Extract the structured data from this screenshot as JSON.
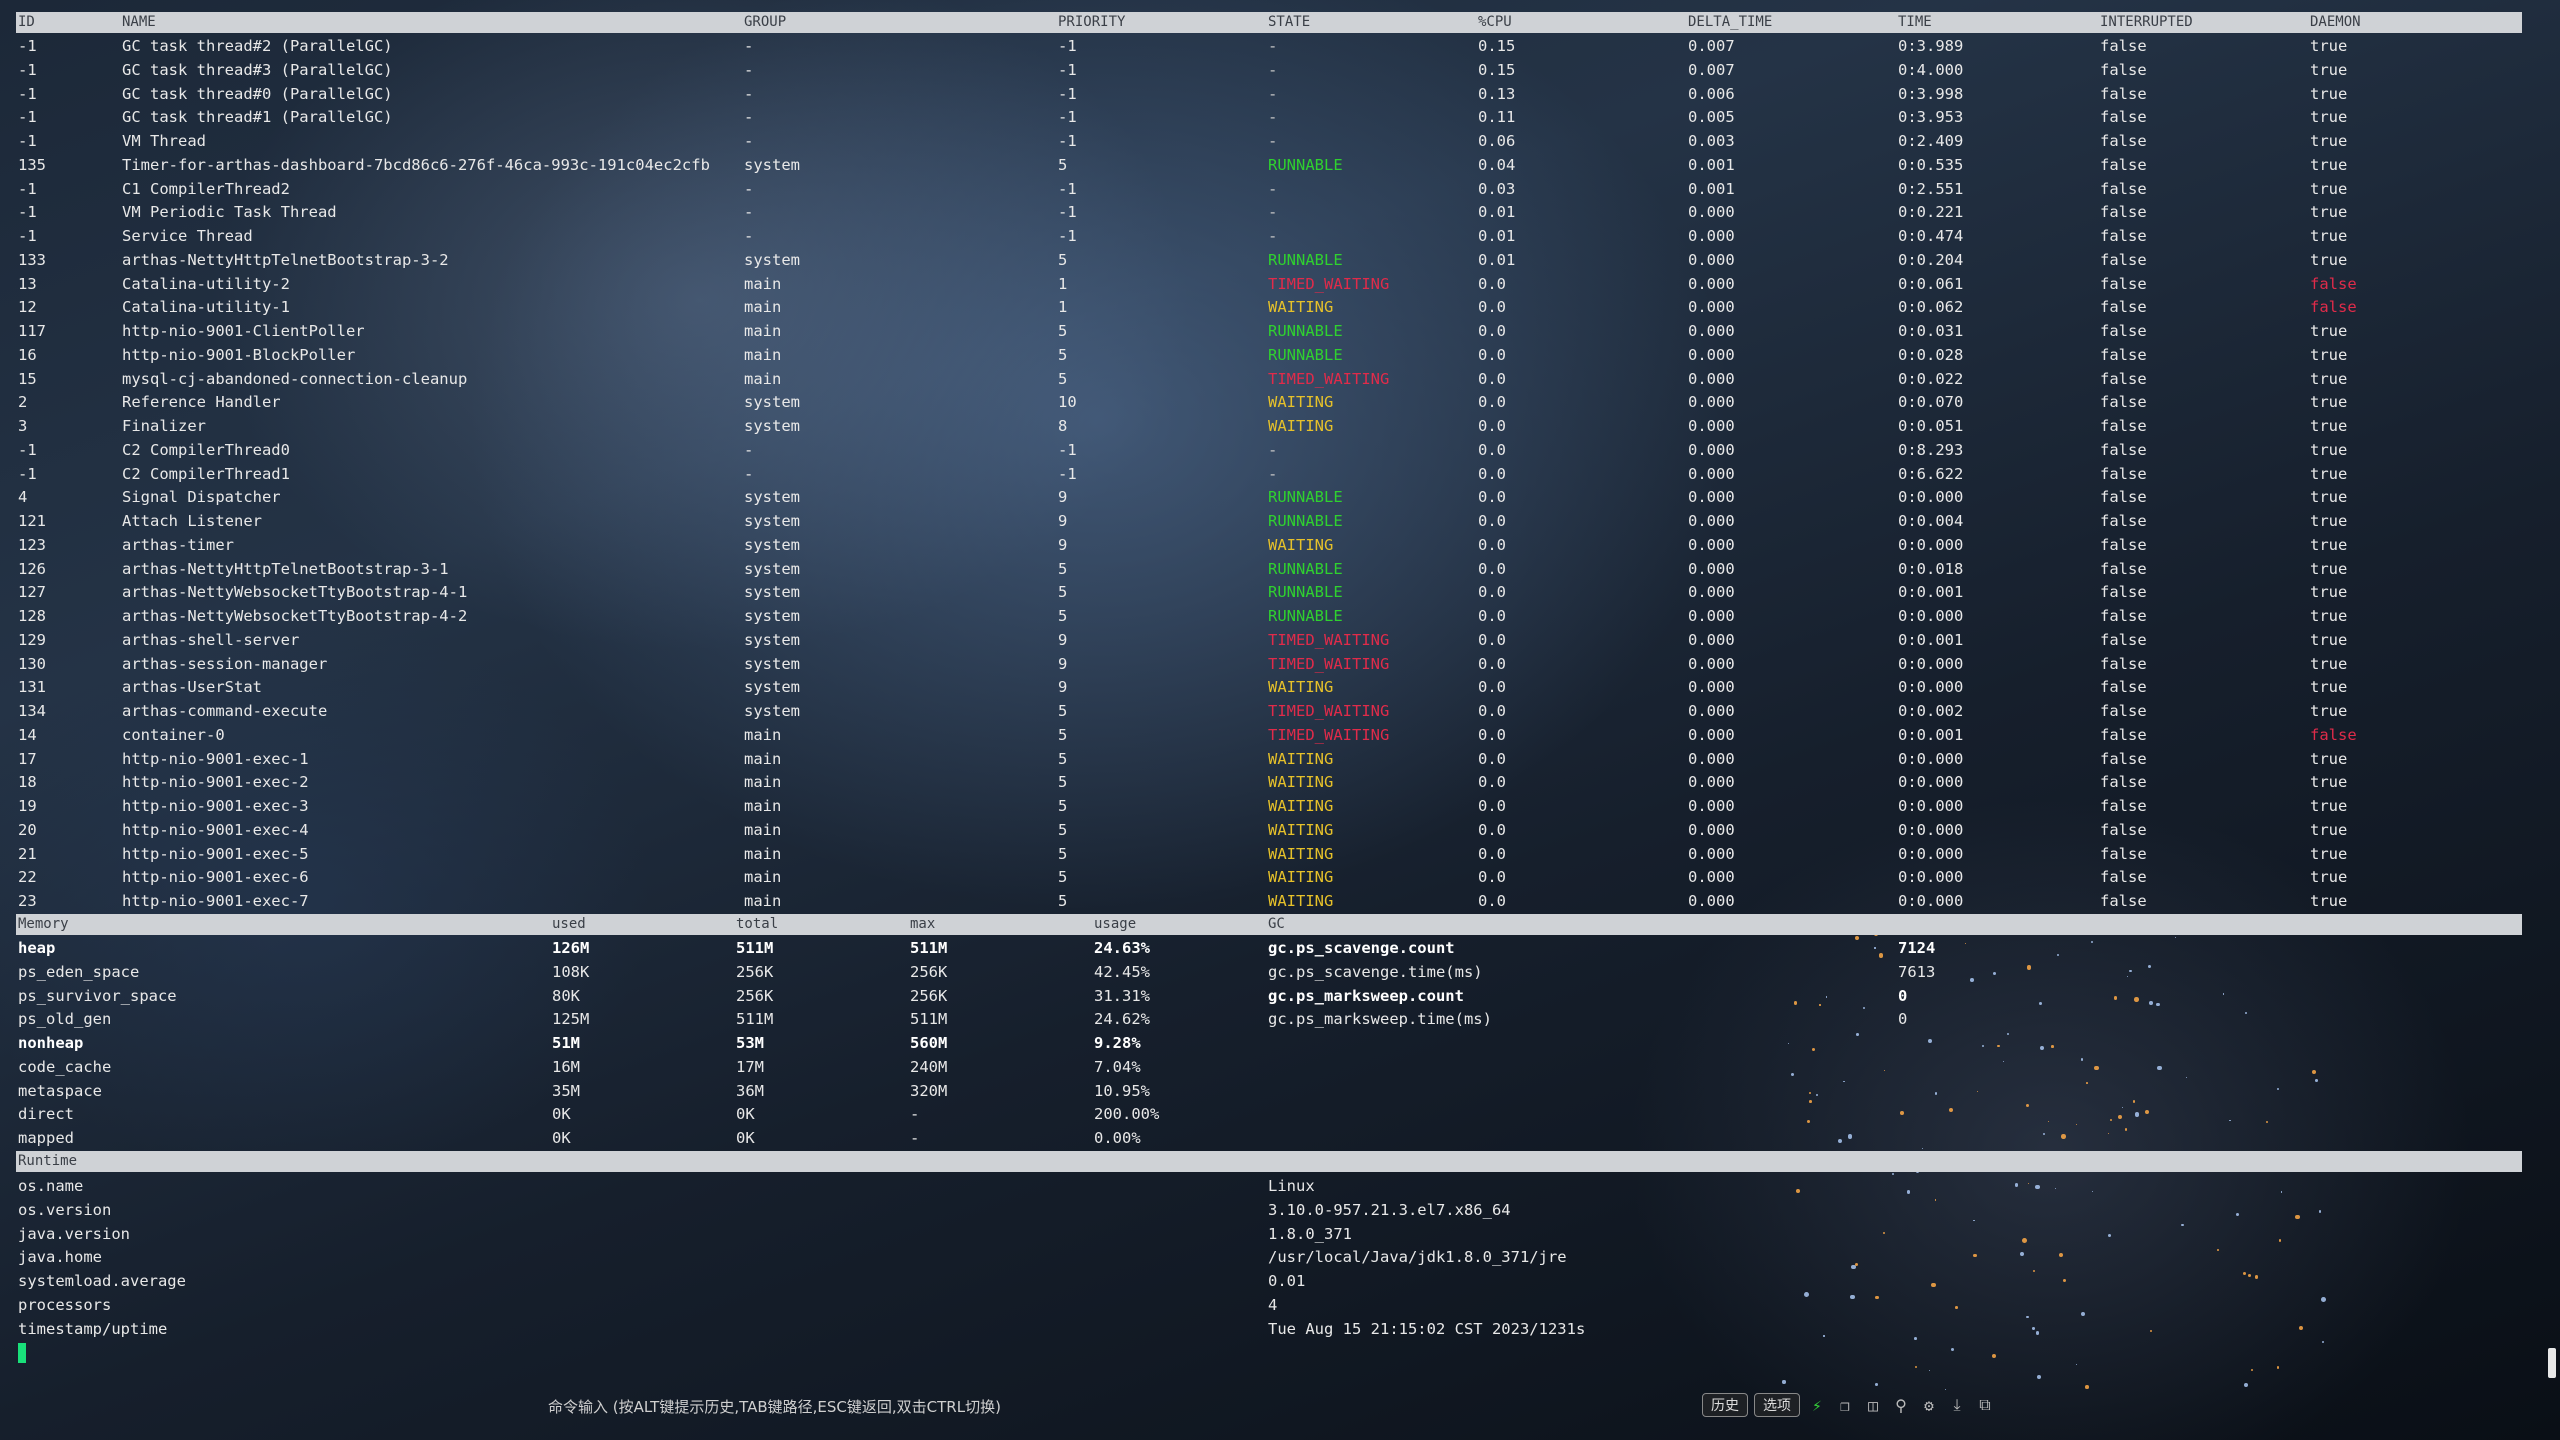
{
  "threads": {
    "headers": [
      "ID",
      "NAME",
      "GROUP",
      "PRIORITY",
      "STATE",
      "%CPU",
      "DELTA_TIME",
      "TIME",
      "INTERRUPTED",
      "DAEMON"
    ],
    "rows": [
      [
        "-1",
        "GC task thread#2 (ParallelGC)",
        "-",
        "-1",
        "-",
        "0.15",
        "0.007",
        "0:3.989",
        "false",
        "true"
      ],
      [
        "-1",
        "GC task thread#3 (ParallelGC)",
        "-",
        "-1",
        "-",
        "0.15",
        "0.007",
        "0:4.000",
        "false",
        "true"
      ],
      [
        "-1",
        "GC task thread#0 (ParallelGC)",
        "-",
        "-1",
        "-",
        "0.13",
        "0.006",
        "0:3.998",
        "false",
        "true"
      ],
      [
        "-1",
        "GC task thread#1 (ParallelGC)",
        "-",
        "-1",
        "-",
        "0.11",
        "0.005",
        "0:3.953",
        "false",
        "true"
      ],
      [
        "-1",
        "VM Thread",
        "-",
        "-1",
        "-",
        "0.06",
        "0.003",
        "0:2.409",
        "false",
        "true"
      ],
      [
        "135",
        "Timer-for-arthas-dashboard-7bcd86c6-276f-46ca-993c-191c04ec2cfb",
        "system",
        "5",
        "RUNNABLE",
        "0.04",
        "0.001",
        "0:0.535",
        "false",
        "true"
      ],
      [
        "-1",
        "C1 CompilerThread2",
        "-",
        "-1",
        "-",
        "0.03",
        "0.001",
        "0:2.551",
        "false",
        "true"
      ],
      [
        "-1",
        "VM Periodic Task Thread",
        "-",
        "-1",
        "-",
        "0.01",
        "0.000",
        "0:0.221",
        "false",
        "true"
      ],
      [
        "-1",
        "Service Thread",
        "-",
        "-1",
        "-",
        "0.01",
        "0.000",
        "0:0.474",
        "false",
        "true"
      ],
      [
        "133",
        "arthas-NettyHttpTelnetBootstrap-3-2",
        "system",
        "5",
        "RUNNABLE",
        "0.01",
        "0.000",
        "0:0.204",
        "false",
        "true"
      ],
      [
        "13",
        "Catalina-utility-2",
        "main",
        "1",
        "TIMED_WAITING",
        "0.0",
        "0.000",
        "0:0.061",
        "false",
        "false"
      ],
      [
        "12",
        "Catalina-utility-1",
        "main",
        "1",
        "WAITING",
        "0.0",
        "0.000",
        "0:0.062",
        "false",
        "false"
      ],
      [
        "117",
        "http-nio-9001-ClientPoller",
        "main",
        "5",
        "RUNNABLE",
        "0.0",
        "0.000",
        "0:0.031",
        "false",
        "true"
      ],
      [
        "16",
        "http-nio-9001-BlockPoller",
        "main",
        "5",
        "RUNNABLE",
        "0.0",
        "0.000",
        "0:0.028",
        "false",
        "true"
      ],
      [
        "15",
        "mysql-cj-abandoned-connection-cleanup",
        "main",
        "5",
        "TIMED_WAITING",
        "0.0",
        "0.000",
        "0:0.022",
        "false",
        "true"
      ],
      [
        "2",
        "Reference Handler",
        "system",
        "10",
        "WAITING",
        "0.0",
        "0.000",
        "0:0.070",
        "false",
        "true"
      ],
      [
        "3",
        "Finalizer",
        "system",
        "8",
        "WAITING",
        "0.0",
        "0.000",
        "0:0.051",
        "false",
        "true"
      ],
      [
        "-1",
        "C2 CompilerThread0",
        "-",
        "-1",
        "-",
        "0.0",
        "0.000",
        "0:8.293",
        "false",
        "true"
      ],
      [
        "-1",
        "C2 CompilerThread1",
        "-",
        "-1",
        "-",
        "0.0",
        "0.000",
        "0:6.622",
        "false",
        "true"
      ],
      [
        "4",
        "Signal Dispatcher",
        "system",
        "9",
        "RUNNABLE",
        "0.0",
        "0.000",
        "0:0.000",
        "false",
        "true"
      ],
      [
        "121",
        "Attach Listener",
        "system",
        "9",
        "RUNNABLE",
        "0.0",
        "0.000",
        "0:0.004",
        "false",
        "true"
      ],
      [
        "123",
        "arthas-timer",
        "system",
        "9",
        "WAITING",
        "0.0",
        "0.000",
        "0:0.000",
        "false",
        "true"
      ],
      [
        "126",
        "arthas-NettyHttpTelnetBootstrap-3-1",
        "system",
        "5",
        "RUNNABLE",
        "0.0",
        "0.000",
        "0:0.018",
        "false",
        "true"
      ],
      [
        "127",
        "arthas-NettyWebsocketTtyBootstrap-4-1",
        "system",
        "5",
        "RUNNABLE",
        "0.0",
        "0.000",
        "0:0.001",
        "false",
        "true"
      ],
      [
        "128",
        "arthas-NettyWebsocketTtyBootstrap-4-2",
        "system",
        "5",
        "RUNNABLE",
        "0.0",
        "0.000",
        "0:0.000",
        "false",
        "true"
      ],
      [
        "129",
        "arthas-shell-server",
        "system",
        "9",
        "TIMED_WAITING",
        "0.0",
        "0.000",
        "0:0.001",
        "false",
        "true"
      ],
      [
        "130",
        "arthas-session-manager",
        "system",
        "9",
        "TIMED_WAITING",
        "0.0",
        "0.000",
        "0:0.000",
        "false",
        "true"
      ],
      [
        "131",
        "arthas-UserStat",
        "system",
        "9",
        "WAITING",
        "0.0",
        "0.000",
        "0:0.000",
        "false",
        "true"
      ],
      [
        "134",
        "arthas-command-execute",
        "system",
        "5",
        "TIMED_WAITING",
        "0.0",
        "0.000",
        "0:0.002",
        "false",
        "true"
      ],
      [
        "14",
        "container-0",
        "main",
        "5",
        "TIMED_WAITING",
        "0.0",
        "0.000",
        "0:0.001",
        "false",
        "false"
      ],
      [
        "17",
        "http-nio-9001-exec-1",
        "main",
        "5",
        "WAITING",
        "0.0",
        "0.000",
        "0:0.000",
        "false",
        "true"
      ],
      [
        "18",
        "http-nio-9001-exec-2",
        "main",
        "5",
        "WAITING",
        "0.0",
        "0.000",
        "0:0.000",
        "false",
        "true"
      ],
      [
        "19",
        "http-nio-9001-exec-3",
        "main",
        "5",
        "WAITING",
        "0.0",
        "0.000",
        "0:0.000",
        "false",
        "true"
      ],
      [
        "20",
        "http-nio-9001-exec-4",
        "main",
        "5",
        "WAITING",
        "0.0",
        "0.000",
        "0:0.000",
        "false",
        "true"
      ],
      [
        "21",
        "http-nio-9001-exec-5",
        "main",
        "5",
        "WAITING",
        "0.0",
        "0.000",
        "0:0.000",
        "false",
        "true"
      ],
      [
        "22",
        "http-nio-9001-exec-6",
        "main",
        "5",
        "WAITING",
        "0.0",
        "0.000",
        "0:0.000",
        "false",
        "true"
      ],
      [
        "23",
        "http-nio-9001-exec-7",
        "main",
        "5",
        "WAITING",
        "0.0",
        "0.000",
        "0:0.000",
        "false",
        "true"
      ]
    ]
  },
  "memory": {
    "headers": [
      "Memory",
      "used",
      "total",
      "max",
      "usage",
      "GC"
    ],
    "rows": [
      {
        "cells": [
          "heap",
          "126M",
          "511M",
          "511M",
          "24.63%"
        ],
        "bold": true
      },
      {
        "cells": [
          "ps_eden_space",
          "108K",
          "256K",
          "256K",
          "42.45%"
        ],
        "bold": false
      },
      {
        "cells": [
          "ps_survivor_space",
          "80K",
          "256K",
          "256K",
          "31.31%"
        ],
        "bold": false
      },
      {
        "cells": [
          "ps_old_gen",
          "125M",
          "511M",
          "511M",
          "24.62%"
        ],
        "bold": false
      },
      {
        "cells": [
          "nonheap",
          "51M",
          "53M",
          "560M",
          "9.28%"
        ],
        "bold": true
      },
      {
        "cells": [
          "code_cache",
          "16M",
          "17M",
          "240M",
          "7.04%"
        ],
        "bold": false
      },
      {
        "cells": [
          "metaspace",
          "35M",
          "36M",
          "320M",
          "10.95%"
        ],
        "bold": false
      },
      {
        "cells": [
          "direct",
          "0K",
          "0K",
          "-",
          "200.00%"
        ],
        "bold": false
      },
      {
        "cells": [
          "mapped",
          "0K",
          "0K",
          "-",
          "0.00%"
        ],
        "bold": false
      }
    ],
    "gc": [
      {
        "name": "gc.ps_scavenge.count",
        "value": "7124",
        "bold": true
      },
      {
        "name": "gc.ps_scavenge.time(ms)",
        "value": "7613",
        "bold": false
      },
      {
        "name": "gc.ps_marksweep.count",
        "value": "0",
        "bold": true
      },
      {
        "name": "gc.ps_marksweep.time(ms)",
        "value": "0",
        "bold": false
      }
    ]
  },
  "runtime": {
    "header": "Runtime",
    "rows": [
      [
        "os.name",
        "Linux"
      ],
      [
        "os.version",
        "3.10.0-957.21.3.el7.x86_64"
      ],
      [
        "java.version",
        "1.8.0_371"
      ],
      [
        "java.home",
        "/usr/local/Java/jdk1.8.0_371/jre"
      ],
      [
        "systemload.average",
        "0.01"
      ],
      [
        "processors",
        "4"
      ],
      [
        "timestamp/uptime",
        "Tue Aug 15 21:15:02 CST 2023/1231s"
      ]
    ]
  },
  "bottom": {
    "hint": "命令输入 (按ALT键提示历史,TAB键路径,ESC键返回,双击CTRL切换)",
    "history_label": "历史",
    "options_label": "选项",
    "icons": [
      "lightning-icon",
      "copy-icon",
      "paste-icon",
      "search-icon",
      "gear-icon",
      "download-icon",
      "window-icon"
    ]
  },
  "colors": {
    "runnable": "#2fd12f",
    "waiting": "#e6c12a",
    "timed_waiting": "#e02b4a",
    "header_bg": "#cfd2d6"
  }
}
